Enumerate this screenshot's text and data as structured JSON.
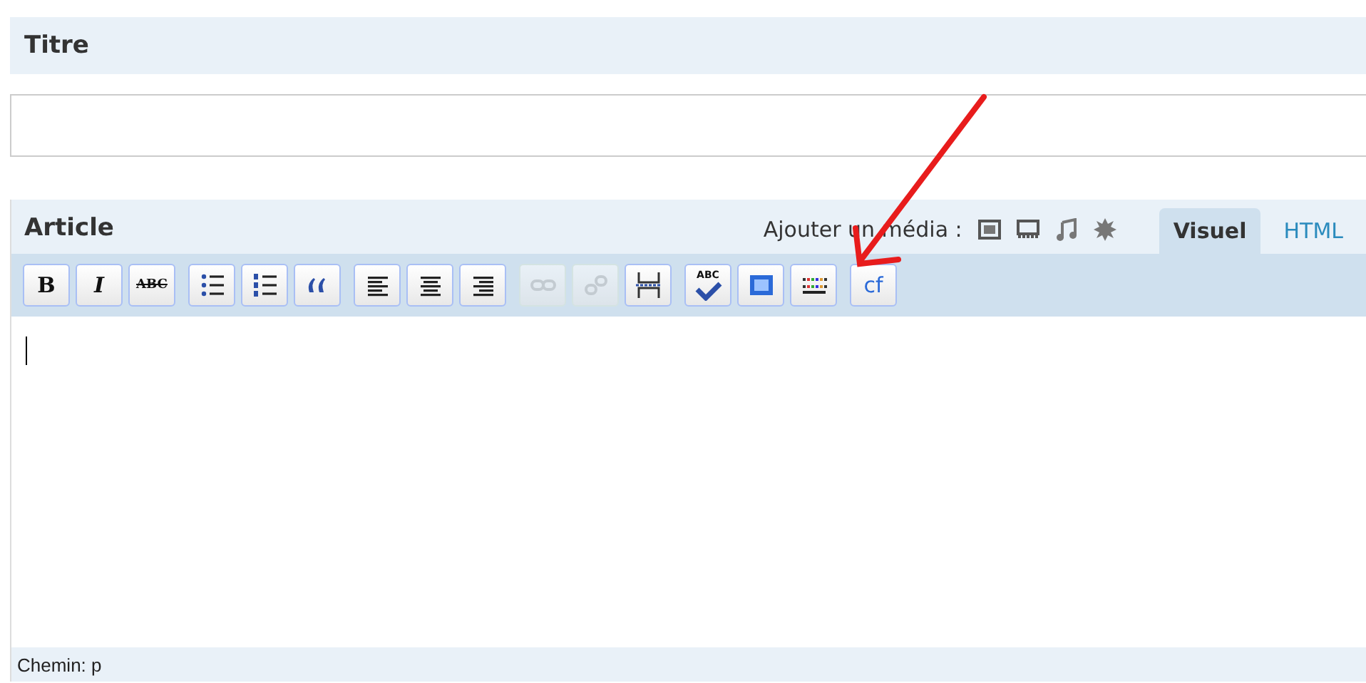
{
  "title_section": {
    "heading": "Titre"
  },
  "article": {
    "heading": "Article",
    "media_label": "Ajouter un média :",
    "tabs": [
      {
        "label": "Visuel",
        "selected": true
      },
      {
        "label": "HTML",
        "selected": false
      }
    ],
    "toolbar": [
      [
        {
          "kind": "bold",
          "label": "B",
          "disabled": false
        },
        {
          "kind": "italic",
          "label": "I",
          "disabled": false
        },
        {
          "kind": "strike",
          "label": "ABC",
          "disabled": false
        }
      ],
      [
        {
          "kind": "bullets",
          "disabled": false
        },
        {
          "kind": "numbers",
          "disabled": false
        },
        {
          "kind": "quote",
          "disabled": false
        }
      ],
      [
        {
          "kind": "align-left",
          "disabled": false
        },
        {
          "kind": "align-center",
          "disabled": false
        },
        {
          "kind": "align-right",
          "disabled": false
        }
      ],
      [
        {
          "kind": "link",
          "disabled": true
        },
        {
          "kind": "unlink",
          "disabled": true
        },
        {
          "kind": "more",
          "disabled": false
        }
      ],
      [
        {
          "kind": "spell",
          "label": "ABC",
          "disabled": false
        },
        {
          "kind": "fullscreen",
          "disabled": false
        },
        {
          "kind": "kitchen",
          "disabled": false
        }
      ],
      [
        {
          "kind": "cf",
          "label": "cf",
          "disabled": false
        }
      ]
    ],
    "path": "Chemin: p"
  }
}
